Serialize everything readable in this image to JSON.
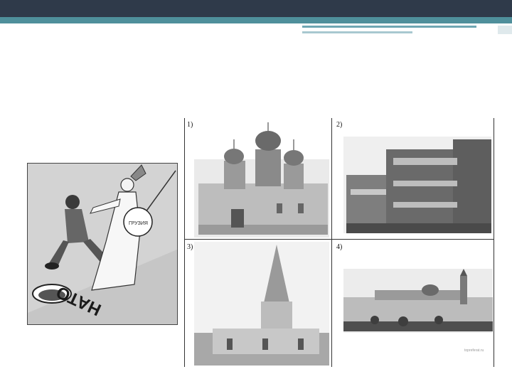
{
  "slide": {
    "cartoon_caption": "НАТО",
    "shield_text": "ГРУЗИЯ"
  },
  "photo_grid": {
    "items": [
      {
        "label": "1)",
        "subject": "church-with-onion-domes-icon"
      },
      {
        "label": "2)",
        "subject": "modernist-building-icon"
      },
      {
        "label": "3)",
        "subject": "tent-roof-church-icon"
      },
      {
        "label": "4)",
        "subject": "palace-complex-icon"
      }
    ],
    "credit": "topreferat.ru"
  },
  "colors": {
    "header_dark": "#2f3a4a",
    "header_teal": "#4f8f9b",
    "accent_light": "#6fa7b3"
  }
}
